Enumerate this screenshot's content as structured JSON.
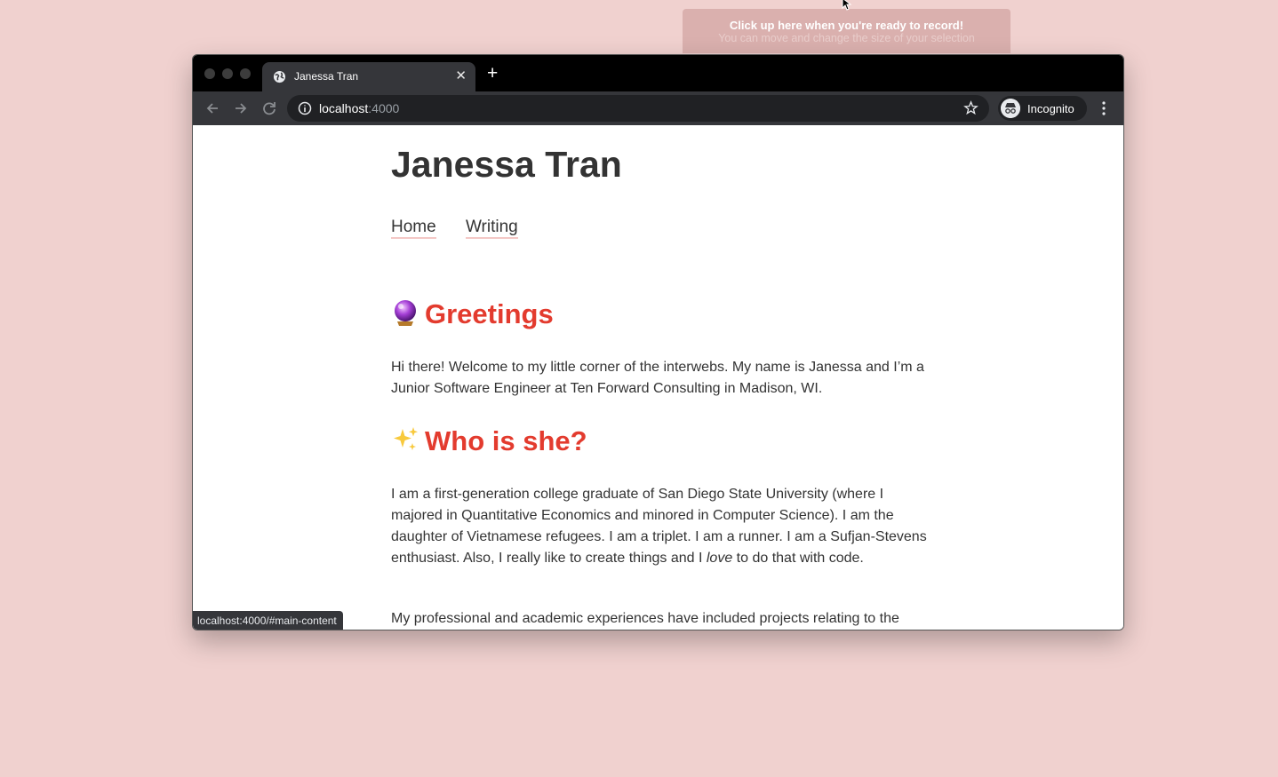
{
  "recorder": {
    "line1": "Click up here when you're ready to record!",
    "line2": "You can move and change the size of your selection"
  },
  "browser": {
    "tab_title": "Janessa Tran",
    "tab_close": "✕",
    "new_tab": "+",
    "url_host": "localhost",
    "url_port": ":4000",
    "profile_label": "Incognito",
    "status_url": "localhost:4000/#main-content"
  },
  "site": {
    "title": "Janessa Tran",
    "nav": [
      "Home",
      "Writing"
    ],
    "greetings_heading": "Greetings",
    "greetings_text": "Hi there! Welcome to my little corner of the interwebs. My name is Janessa and I’m a Junior Software Engineer at Ten Forward Consulting in Madison, WI.",
    "who_heading": "Who is she?",
    "who_text_1": "I am a first-generation college graduate of San Diego State University (where I majored in Quantitative Economics and minored in Computer Science). I am the daughter of Vietnamese refugees. I am a triplet. I am a runner. I am a Sufjan-Stevens enthusiast. Also, I really like to create things and I ",
    "who_text_em": "love",
    "who_text_2": " to do that with code.",
    "professional_text": "My professional and academic experiences have included projects relating to the"
  },
  "colors": {
    "background": "#f0d1cf",
    "heading_accent": "#e33b2e",
    "nav_underline": "#f4c8c5"
  },
  "icons": [
    "globe-icon",
    "back-icon",
    "forward-icon",
    "reload-icon",
    "info-icon",
    "star-icon",
    "incognito-icon",
    "menu-icon",
    "crystal-ball-icon",
    "sparkles-icon"
  ]
}
